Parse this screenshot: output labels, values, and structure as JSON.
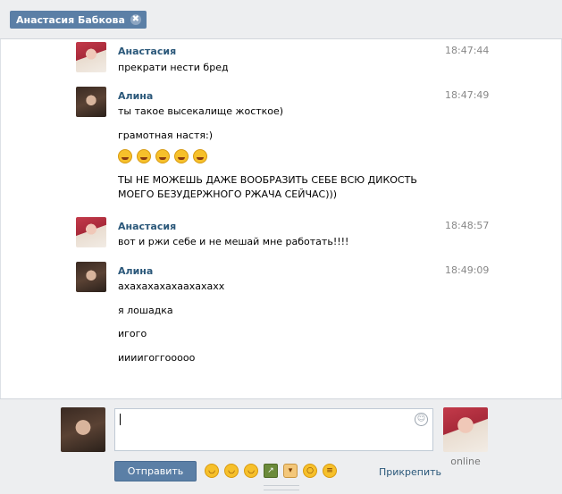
{
  "tab": {
    "title": "Анастасия Бабкова",
    "close_glyph": "✖"
  },
  "messages": [
    {
      "author": "Анастасия",
      "time": "18:47:44",
      "avatar": "anastasia-avatar",
      "lines": [
        "прекрати нести бред"
      ]
    },
    {
      "author": "Алина",
      "time": "18:47:49",
      "avatar": "alina-avatar",
      "lines": [
        "ты такое высекалище жосткое)",
        "грамотная настя:)",
        "",
        "ТЫ НЕ МОЖЕШЬ ДАЖЕ ВООБРАЗИТЬ СЕБЕ ВСЮ ДИКОСТЬ МОЕГО БЕЗУДЕРЖНОГО РЖАЧА СЕЙЧАС)))"
      ],
      "smiley_count": 5
    },
    {
      "author": "Анастасия",
      "time": "18:48:57",
      "avatar": "anastasia-avatar",
      "lines": [
        "вот и ржи себе и не мешай мне работать!!!!"
      ]
    },
    {
      "author": "Алина",
      "time": "18:49:09",
      "avatar": "alina-avatar",
      "lines": [
        "ахахахахахаахахахх",
        "я лошадка",
        "игого",
        "иииигоггооооо"
      ]
    }
  ],
  "composer": {
    "value": "",
    "send_label": "Отправить",
    "attach_label": "Прикрепить",
    "peer_status": "online",
    "quick_emoji": [
      "laughing-icon",
      "relieved-icon",
      "blush-icon",
      "champagne-icon",
      "thumbs-down-icon",
      "kissing-icon",
      "grimacing-icon"
    ]
  },
  "colors": {
    "accent": "#5b7fa6",
    "author": "#2b587a",
    "panel": "#edeef0"
  }
}
